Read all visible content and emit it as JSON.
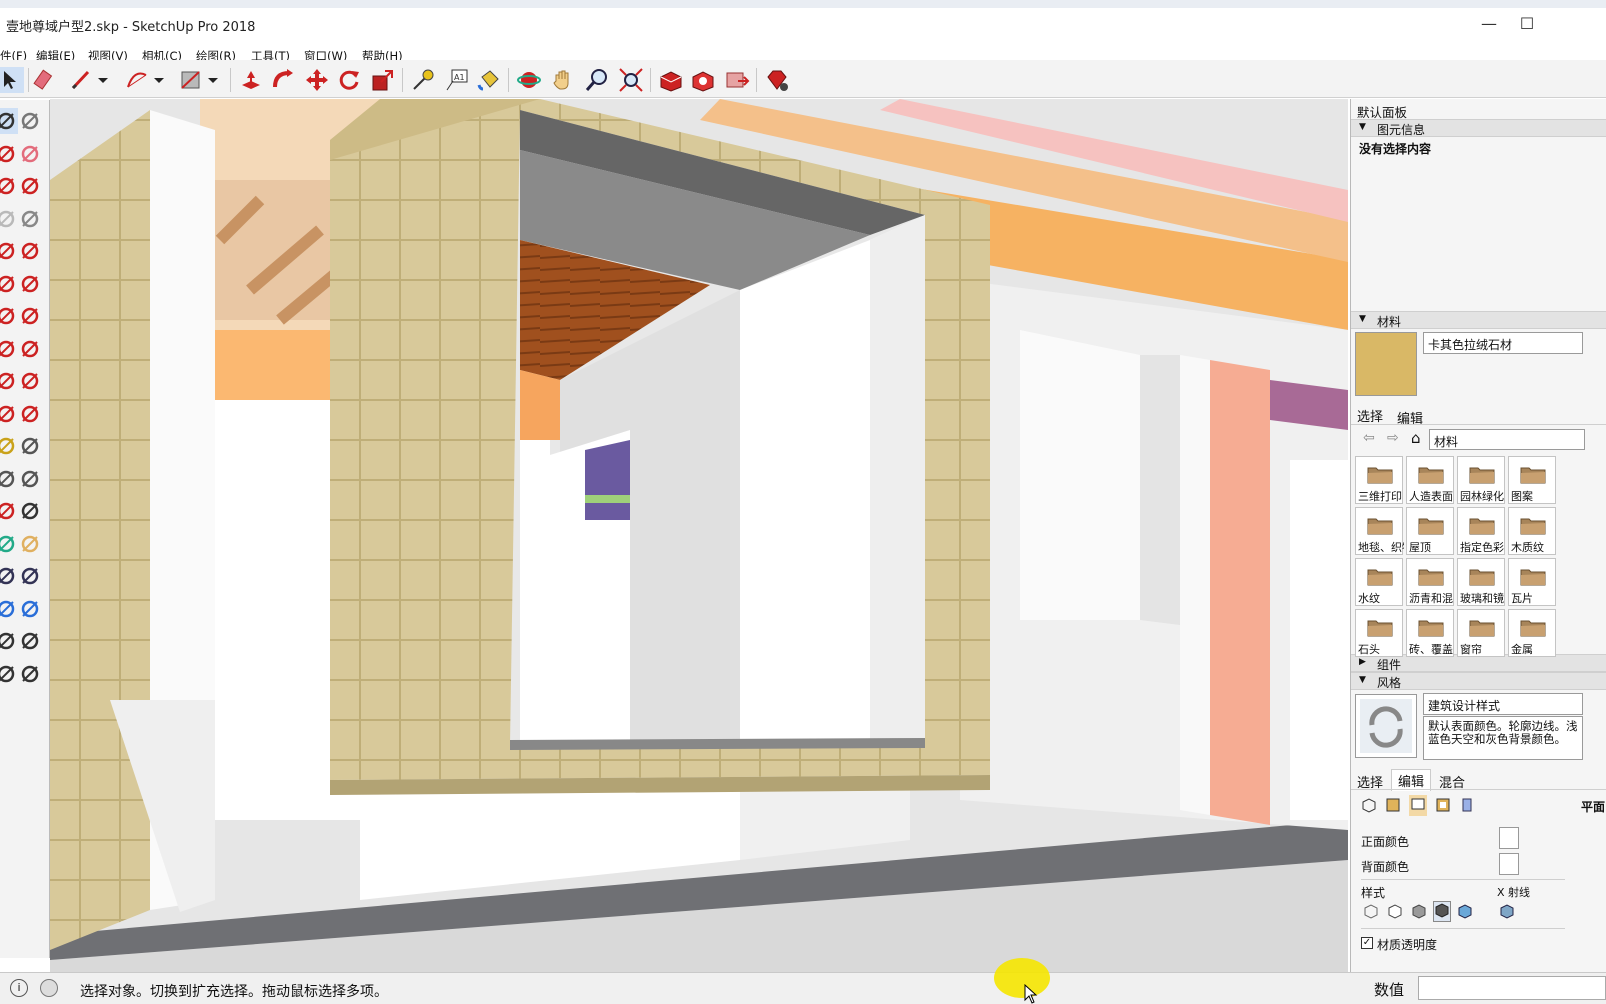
{
  "window": {
    "title": "壹地尊域户型2.skp - SketchUp Pro 2018",
    "minimize_glyph": "—",
    "maximize_glyph": "☐"
  },
  "menu": {
    "items": [
      "件(F)",
      "编辑(E)",
      "视图(V)",
      "相机(C)",
      "绘图(R)",
      "工具(T)",
      "窗口(W)",
      "帮助(H)"
    ]
  },
  "toolbar": {
    "icons": [
      "select-icon",
      "eraser-icon",
      "pencil-icon",
      "dropdown-icon",
      "arc-icon",
      "dropdown-icon",
      "rectangle-icon",
      "dropdown-icon",
      "push-pull-icon",
      "follow-me-icon",
      "move-icon",
      "rotate-icon",
      "scale-icon",
      "tape-measure-icon",
      "text-label-icon",
      "paint-bucket-icon",
      "orbit-icon",
      "pan-icon",
      "zoom-icon",
      "zoom-extents-icon",
      "warehouse-icon",
      "extension-warehouse-icon",
      "send-to-layout-icon",
      "ruby-console-icon"
    ]
  },
  "left_toolbar": {
    "icons": [
      "select-icon",
      "make-component-icon",
      "paint-bucket-icon",
      "eraser-icon",
      "line-icon",
      "freehand-icon",
      "rectangle-icon",
      "rotated-rectangle-icon",
      "circle-icon",
      "polygon-icon",
      "arc-icon",
      "two-point-arc-icon",
      "three-point-arc-icon",
      "pie-icon",
      "move-icon",
      "push-pull-icon",
      "rotate-icon",
      "follow-me-icon",
      "scale-icon",
      "offset-icon",
      "tape-measure-icon",
      "dimension-icon",
      "protractor-icon",
      "text-icon",
      "axes-icon",
      "3d-text-icon",
      "orbit-icon",
      "pan-icon",
      "zoom-icon",
      "zoom-window-icon",
      "zoom-extents-icon",
      "previous-view-icon",
      "position-camera-icon",
      "look-around-icon",
      "walk-icon",
      "section-plane-icon"
    ]
  },
  "panel": {
    "tray_title": "默认面板",
    "entity_info": {
      "header": "图元信息",
      "empty_text": "没有选择内容"
    },
    "materials": {
      "header": "材料",
      "material_name": "卡其色拉绒石材",
      "tabs": [
        "选择",
        "编辑"
      ],
      "library_select": "材料",
      "tiles": [
        "三维打印",
        "人造表面",
        "园林绿化",
        "图案",
        "地毯、织物",
        "屋顶",
        "指定色彩",
        "木质纹",
        "水纹",
        "沥青和混",
        "玻璃和镜",
        "瓦片",
        "石头",
        "砖、覆盖",
        "窗帘",
        "金属"
      ],
      "swatch_color": "#d9b866"
    },
    "components": {
      "header": "组件"
    },
    "styles": {
      "header": "风格",
      "style_name": "建筑设计样式",
      "description": "默认表面颜色。轮廓边线。浅蓝色天空和灰色背景颜色。",
      "tabs": [
        "选择",
        "编辑",
        "混合"
      ],
      "right_label": "平面",
      "front_color_label": "正面颜色",
      "back_color_label": "背面颜色",
      "style_label": "样式",
      "xray_label": "X 射线",
      "transparency_label": "材质透明度",
      "transparency_checked": true
    }
  },
  "statusbar": {
    "message": "选择对象。切换到扩充选择。拖动鼠标选择多项。",
    "vcb_label": "数值",
    "vcb_value": ""
  }
}
